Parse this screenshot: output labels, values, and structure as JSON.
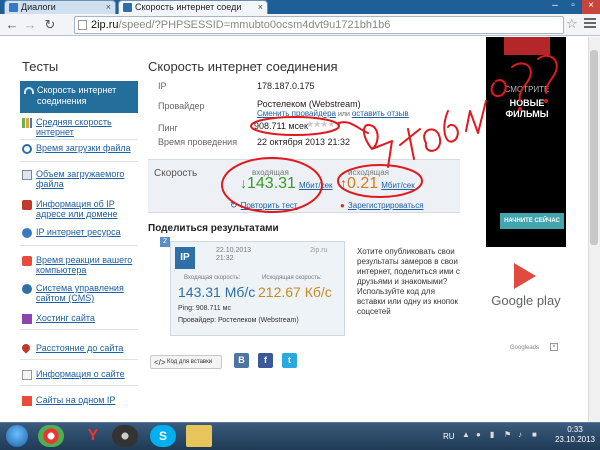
{
  "browser": {
    "tabs": [
      {
        "label": "Диалоги"
      },
      {
        "label": "Скорость интернет соеди"
      }
    ],
    "url_domain": "2ip.ru",
    "url_path": "/speed/?PHPSESSID=mmubto0ocsm4dvt9u1721bh1b6"
  },
  "sidebar": {
    "title": "Тесты",
    "active": "Скорость интернет соединения",
    "items": [
      {
        "label": "Средняя скорость интернет",
        "icon": "bars-icon"
      },
      {
        "label": "Время загрузки файла",
        "icon": "clock-icon"
      },
      {
        "label": "Объем загружаемого файла",
        "icon": "file-icon"
      },
      {
        "label": "Информация об IP адресе или домене",
        "icon": "info-icon"
      },
      {
        "label": "IP интернет ресурса",
        "icon": "globe-icon"
      },
      {
        "label": "Время реакции вашего компьютера",
        "icon": "pc-icon"
      },
      {
        "label": "Система управления сайтом (CMS)",
        "icon": "cms-icon"
      },
      {
        "label": "Хостинг сайта",
        "icon": "hosting-icon"
      },
      {
        "label": "Расстояние до сайта",
        "icon": "pin-icon"
      },
      {
        "label": "Информация о сайте",
        "icon": "doc-icon"
      },
      {
        "label": "Сайты на одном IP",
        "icon": "ip-icon"
      }
    ]
  },
  "main": {
    "title": "Скорость интернет соединения",
    "ip_label": "IP",
    "ip_value": "178.187.0.175",
    "provider_label": "Провайдер",
    "provider_value": "Ростелеком (Webstream)",
    "change_provider": "Сменить провайдера",
    "or": "или",
    "leave_review": "оставить отзыв",
    "ping_label": "Пинг",
    "ping_value": "908.711 мсек",
    "time_label": "Время проведения",
    "time_value": "22 октября 2013 21:32",
    "speed_label": "Скорость",
    "incoming_label": "входящая",
    "incoming_value": "143.31",
    "incoming_unit": "Мбит/сек",
    "outgoing_label": "исходящая",
    "outgoing_value": "0.21",
    "outgoing_unit": "Мбит/сек",
    "repeat_test": "Повторить тест",
    "register": "Зарегистрироваться",
    "share_title": "Поделиться результатами",
    "share_text": "Хотите опубликовать свои результаты замеров в свои интернет, поделиться ими с друзьями и знакомыми? Используйте код для вставки или одну из кнопок соцсетей",
    "embed_button": "Код для вставки"
  },
  "card": {
    "num": "2",
    "logo": "IP",
    "date": "22.10.2013",
    "time": "21:32",
    "brand": "2ip.ru",
    "down_label": "Входящая скорость:",
    "up_label": "Исходящая скорость:",
    "down_value": "143.31 Мб/с",
    "up_value": "212.67 Кб/с",
    "ping": "Ping: 908.711 мс",
    "provider": "Провайдер:  Ростелеком (Webstream)"
  },
  "ad": {
    "line1": "СМОТРИТЕ",
    "line2": "НОВЫЕ ФИЛЬМЫ",
    "button": "НАЧНИТЕ СЕЙЧАС",
    "store": "Google play",
    "foot": "Googleads"
  },
  "scribble_text": "что бля??",
  "taskbar": {
    "lang": "RU",
    "time": "0:33",
    "date": "23.10.2013"
  },
  "colors": {
    "accent": "#246e9c",
    "incoming": "#3a9a2a",
    "outgoing": "#d67a1a",
    "scribble": "#e0191e"
  }
}
